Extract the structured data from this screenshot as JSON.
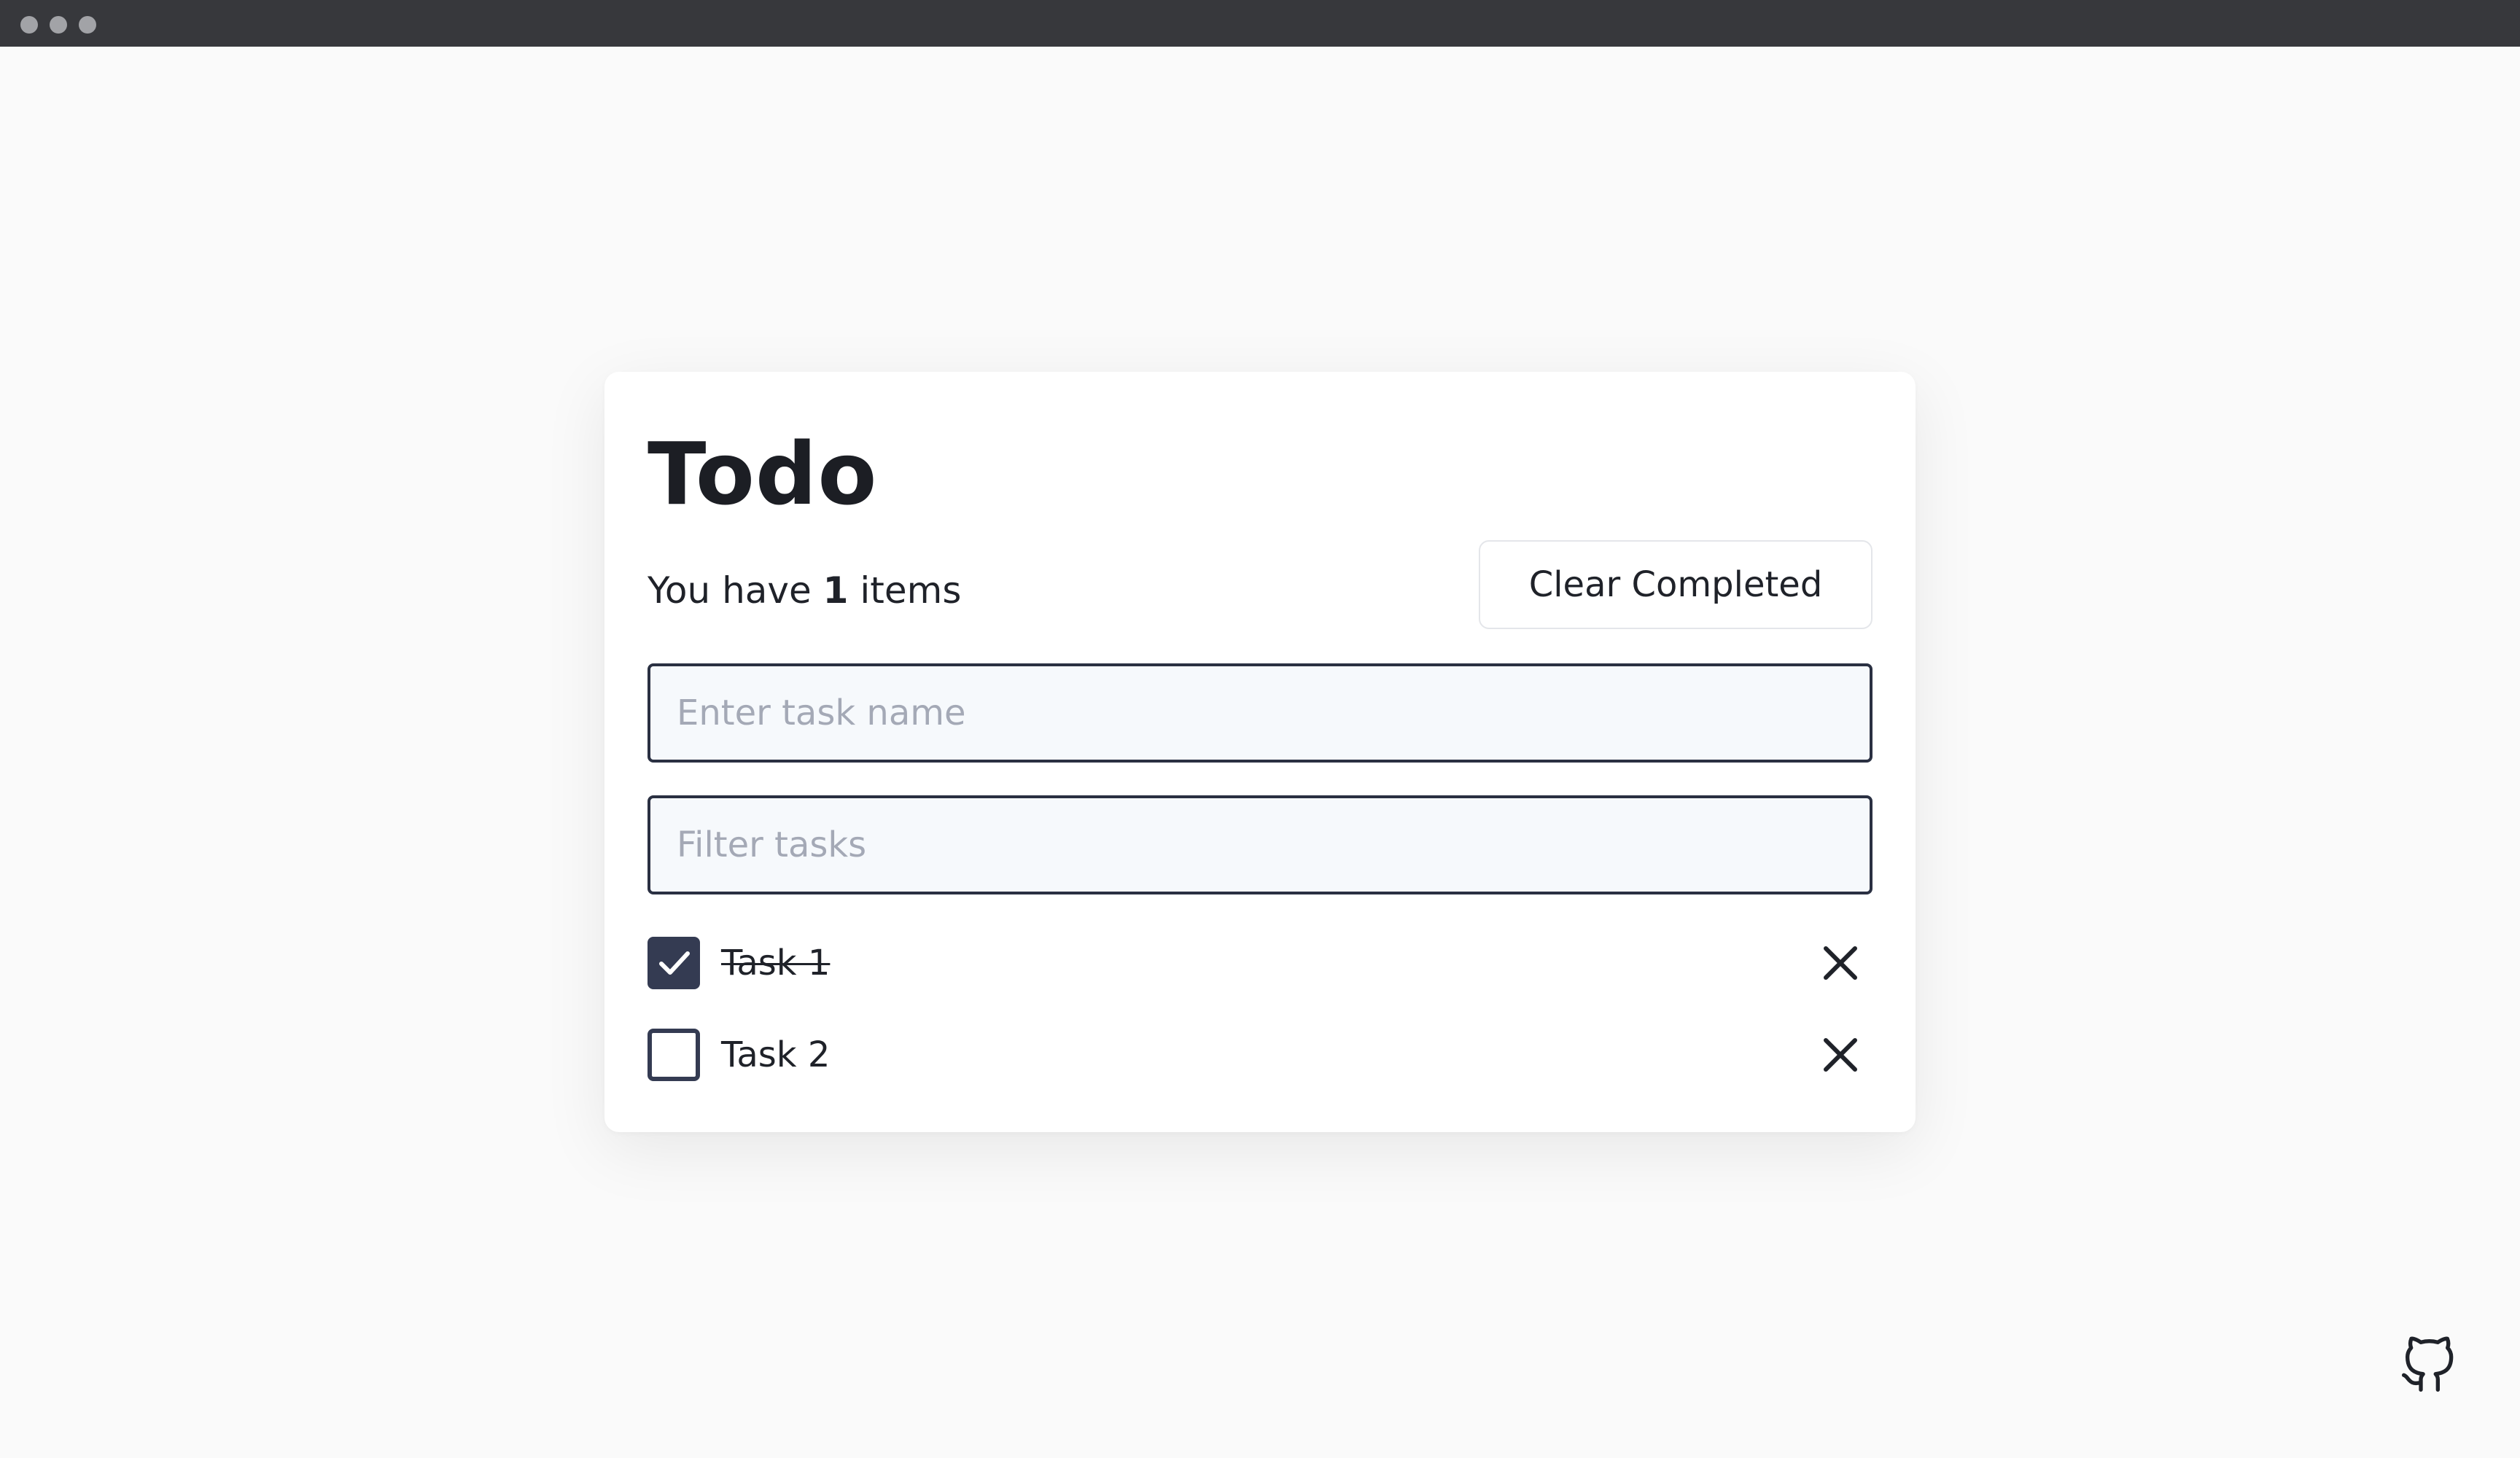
{
  "window": {
    "controls": [
      "close-dot",
      "minimize-dot",
      "maximize-dot"
    ]
  },
  "todo": {
    "title": "Todo",
    "count_prefix": "You have",
    "count_value": "1",
    "count_suffix": "items",
    "clear_label": "Clear Completed",
    "new_task": {
      "placeholder": "Enter task name",
      "value": ""
    },
    "filter": {
      "placeholder": "Filter tasks",
      "value": ""
    },
    "tasks": [
      {
        "label": "Task 1",
        "completed": true
      },
      {
        "label": "Task 2",
        "completed": false
      }
    ]
  },
  "icons": {
    "checkmark": "checkmark-icon",
    "delete": "close-icon",
    "github": "github-icon"
  },
  "colors": {
    "titlebar": "#37383c",
    "background": "#fafafa",
    "accent": "#343b52",
    "text": "#1f2229",
    "placeholder": "#a4a9b6"
  }
}
